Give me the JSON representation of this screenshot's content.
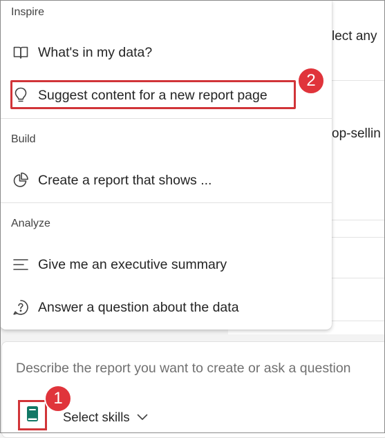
{
  "background": {
    "fragments": [
      "lect any",
      "op-sellin"
    ]
  },
  "menu": {
    "sections": [
      {
        "header": "Inspire",
        "items": [
          {
            "label": "What's in my data?",
            "icon": "book-open-icon"
          },
          {
            "label": "Suggest content for a new report page",
            "icon": "lightbulb-icon"
          }
        ]
      },
      {
        "header": "Build",
        "items": [
          {
            "label": "Create a report that shows ...",
            "icon": "pie-chart-icon"
          }
        ]
      },
      {
        "header": "Analyze",
        "items": [
          {
            "label": "Give me an executive summary",
            "icon": "text-lines-icon"
          },
          {
            "label": "Answer a question about the data",
            "icon": "question-circle-icon"
          }
        ]
      }
    ]
  },
  "input": {
    "placeholder": "Describe the report you want to create or ask a question",
    "skills_label": "Select skills"
  },
  "callouts": {
    "badge1": "1",
    "badge2": "2",
    "color": "#d13438"
  }
}
